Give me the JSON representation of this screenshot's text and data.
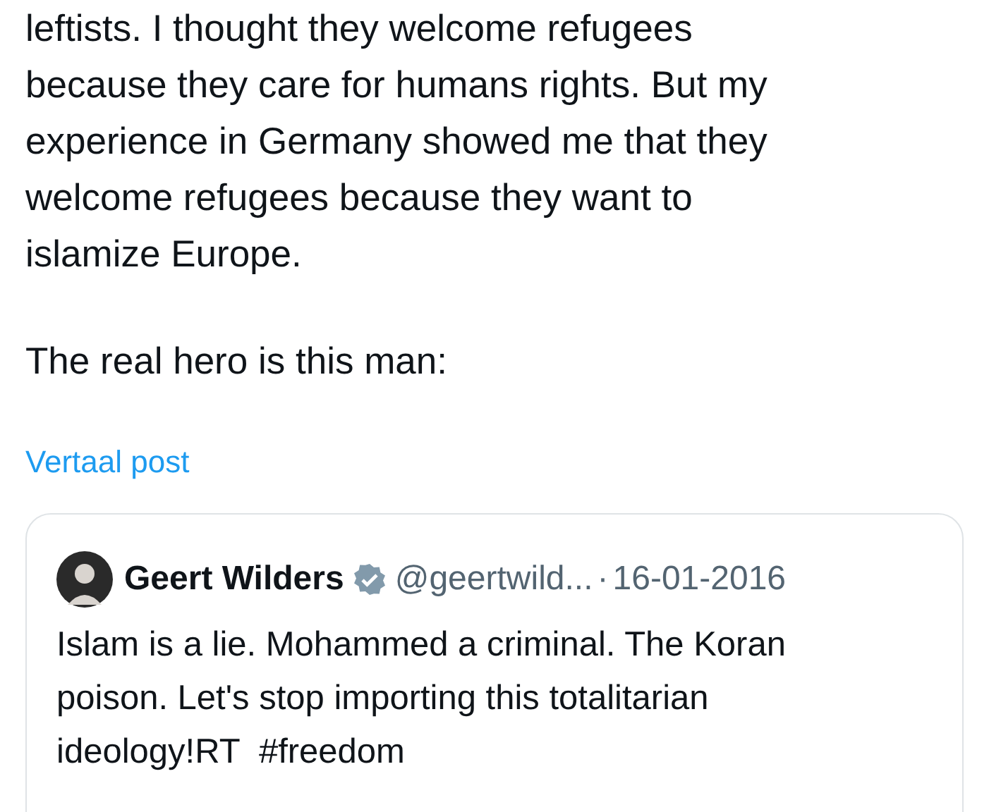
{
  "post": {
    "text_lines": [
      "leftists. I thought they welcome refugees",
      "because they care for humans rights. But my",
      "experience in Germany showed me that they",
      "welcome refugees because they want to",
      "islamize Europe."
    ],
    "second_paragraph": "The real hero is this man:",
    "translate_link": "Vertaal post"
  },
  "quoted_post": {
    "name": "Geert Wilders",
    "verified": true,
    "handle": "@geertwild...",
    "separator": "·",
    "date": "16-01-2016",
    "text_lines": [
      "Islam is a lie. Mohammed a criminal. The Koran",
      "poison. Let's stop importing this totalitarian",
      "ideology!RT  #freedom"
    ]
  }
}
